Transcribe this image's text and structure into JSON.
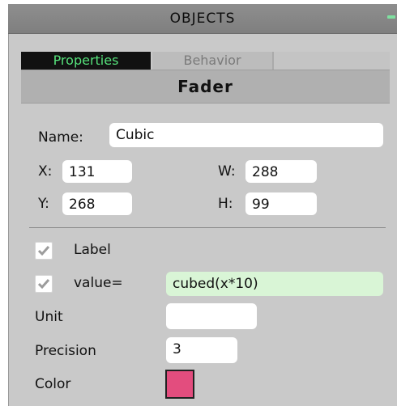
{
  "window": {
    "title": "OBJECTS"
  },
  "tabs": [
    {
      "label": "Properties",
      "active": true
    },
    {
      "label": "Behavior",
      "active": false
    }
  ],
  "object_type": "Fader",
  "properties": {
    "name_label": "Name:",
    "name_value": "Cubic",
    "x_label": "X:",
    "x_value": "131",
    "y_label": "Y:",
    "y_value": "268",
    "w_label": "W:",
    "w_value": "288",
    "h_label": "H:",
    "h_value": "99"
  },
  "options": {
    "label_text": "Label",
    "label_checked": true,
    "value_text": "value=",
    "value_checked": true,
    "value_expression": "cubed(x*10)",
    "unit_label": "Unit",
    "unit_value": "",
    "precision_label": "Precision",
    "precision_value": "3",
    "color_label": "Color",
    "color_value": "#e34d7e"
  },
  "colors": {
    "active_tab_text": "#55e07a",
    "active_tab_bg": "#111111",
    "panel_bg": "#c9c9c9"
  }
}
